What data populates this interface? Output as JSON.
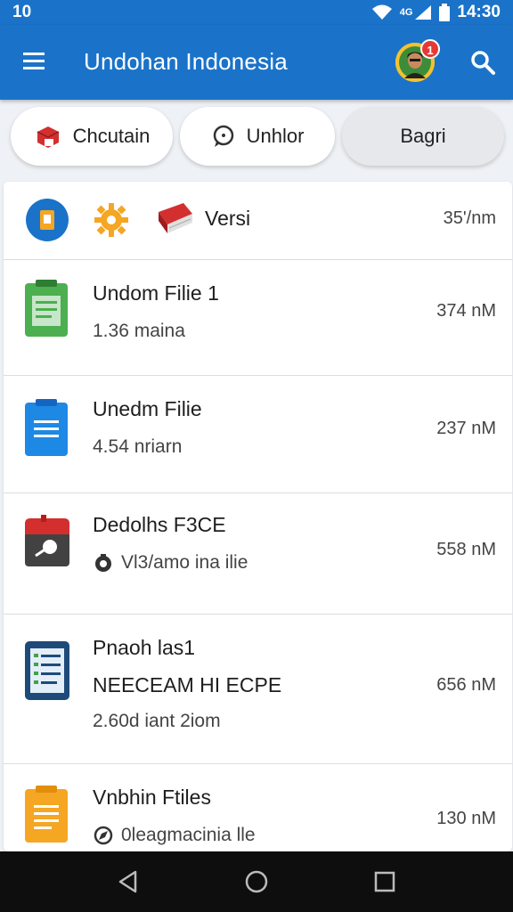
{
  "status_bar": {
    "time_left": "10",
    "time_right": "14:30",
    "signal_text": "4G"
  },
  "app_bar": {
    "title": "Undohan Indonesia",
    "notification_count": "1"
  },
  "chips": [
    {
      "label": "Chcutain"
    },
    {
      "label": "Unhlor"
    },
    {
      "label": "Bagri"
    }
  ],
  "header_row": {
    "label": "Versi",
    "size": "35'/nm"
  },
  "files": [
    {
      "title": "Undom Filie 1",
      "subtitle": "1.36 maina",
      "size": "374 nM",
      "icon": "green-document-icon"
    },
    {
      "title": "Unedm Filie",
      "subtitle": "4.54 nriarn",
      "size": "237 nM",
      "icon": "blue-document-icon"
    },
    {
      "title": "Dedolhs F3CE",
      "subtitle": "Vl3/amo ina ilie",
      "size": "558 nM",
      "icon": "red-archive-icon"
    },
    {
      "title": "Pnaoh las1",
      "title2": "NEECEAM HI ECPE",
      "subtitle": "2.60d iant 2iom",
      "size": "656 nM",
      "icon": "navy-checklist-icon"
    },
    {
      "title": "Vnbhin Ftiles",
      "subtitle": "0leagmacinia lle",
      "size": "130 nM",
      "icon": "orange-document-icon"
    }
  ],
  "colors": {
    "primary": "#1a73c9",
    "accent_orange": "#f5a623",
    "badge_red": "#e53935"
  }
}
